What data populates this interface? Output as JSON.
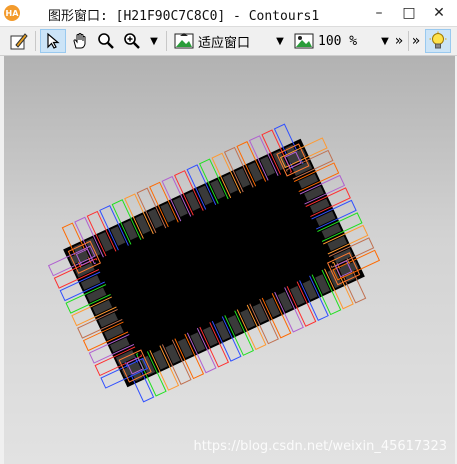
{
  "window": {
    "logo_text": "HA",
    "title": "图形窗口: [H21F90C7C8C0] - Contours1",
    "minimize_glyph": "–",
    "maximize_glyph": "□",
    "close_glyph": "✕"
  },
  "toolbar": {
    "fit_label": "适应窗口",
    "zoom_value": "100 %",
    "overflow_glyph": "»",
    "dropdown_glyph": "▼"
  },
  "watermark": "https://blog.csdn.net/weixin_45617323",
  "colors": {
    "contour_colors": [
      "#ff6a00",
      "#b060d0",
      "#ff3030",
      "#3050ff",
      "#20e020",
      "#ff9930",
      "#c07050"
    ],
    "component_fill": "#000000",
    "accent": "#f39b2d"
  }
}
